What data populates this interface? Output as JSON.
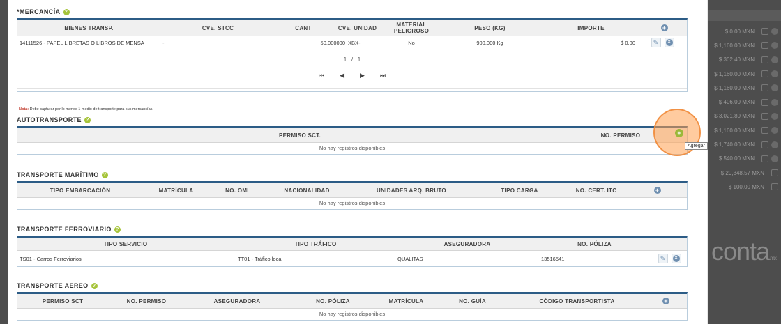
{
  "background": {
    "amounts": [
      "$ 0.00 MXN",
      "$ 1,160.00 MXN",
      "$ 302.40 MXN",
      "$ 1,160.00 MXN",
      "$ 1,160.00 MXN",
      "$ 406.00 MXN",
      "$ 3,021.80 MXN",
      "$ 1,160.00 MXN",
      "$ 1,740.00 MXN",
      "$ 540.00 MXN",
      "$ 29,348.57 MXN",
      "$ 100.00 MXN"
    ],
    "brand": "conta",
    "brand_suffix": ".mx"
  },
  "mercancia": {
    "title": "*MERCANCÍA",
    "headers": [
      "BIENES TRANSP.",
      "CVE. STCC",
      "CANT",
      "CVE. UNIDAD",
      "MATERIAL PELIGROSO",
      "PESO (KG)",
      "IMPORTE"
    ],
    "rows": [
      {
        "bienes": "14111526 - PAPEL LIBRETAS O LIBROS DE MENSA",
        "stcc": "-",
        "cant": "50.000000",
        "unidad": "XBX-",
        "peligroso": "No",
        "peso": "900.000 Kg",
        "importe": "$ 0.00"
      }
    ],
    "pager": {
      "page": "1",
      "sep": "/",
      "total": "1"
    }
  },
  "note": {
    "label": "Nota:",
    "text": " Debe capturar por lo menos 1 medio de transporte para sus mercancías."
  },
  "autotransporte": {
    "title": "AUTOTRANSPORTE",
    "headers": [
      "PERMISO SCT.",
      "NO. PERMISO"
    ],
    "empty": "No hay registros disponibles",
    "tooltip": "Agregar"
  },
  "maritimo": {
    "title": "TRANSPORTE MARÍTIMO",
    "headers": [
      "TIPO EMBARCACIÓN",
      "MATRÍCULA",
      "NO. OMI",
      "NACIONALIDAD",
      "UNIDADES ARQ. BRUTO",
      "TIPO CARGA",
      "NO. CERT. ITC"
    ],
    "empty": "No hay registros disponibles"
  },
  "ferroviario": {
    "title": "TRANSPORTE FERROVIARIO",
    "headers": [
      "TIPO SERVICIO",
      "TIPO TRÁFICO",
      "ASEGURADORA",
      "NO. PÓLIZA"
    ],
    "rows": [
      {
        "servicio": "TS01 - Carros Ferroviarios",
        "trafico": "TT01 - Tráfico local",
        "aseguradora": "QUALITAS",
        "poliza": "13516541"
      }
    ]
  },
  "aereo": {
    "title": "TRANSPORTE AEREO",
    "headers": [
      "PERMISO SCT",
      "NO. PERMISO",
      "ASEGURADORA",
      "NO. PÓLIZA",
      "MATRÍCULA",
      "NO. GUÍA",
      "CÓDIGO TRANSPORTISTA"
    ],
    "empty": "No hay registros disponibles"
  }
}
